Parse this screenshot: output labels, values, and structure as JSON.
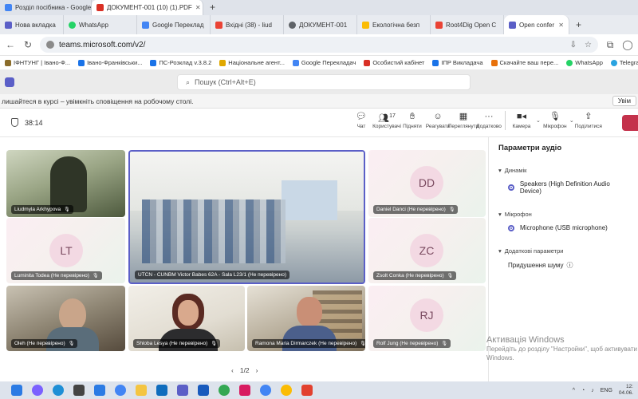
{
  "browser": {
    "top_tabs": [
      {
        "title": "Розділ посібника - Google Докум",
        "color": "#4285f4"
      },
      {
        "title": "ДОКУМЕНТ-001 (10) (1).PDF",
        "color": "#d93025"
      }
    ],
    "tabs": [
      {
        "title": "Нова вкладка",
        "color": "#5b5fc7"
      },
      {
        "title": "WhatsApp",
        "color": "#25d366"
      },
      {
        "title": "Google Переклад",
        "color": "#4285f4"
      },
      {
        "title": "Вхідні (38) - liud",
        "color": "#ea4335"
      },
      {
        "title": "ДОКУМЕНТ-001",
        "color": "#5f6368"
      },
      {
        "title": "Екологічна безп",
        "color": "#fbbc04"
      },
      {
        "title": "Root4Dig Open C",
        "color": "#ea4335"
      },
      {
        "title": "Open confer",
        "color": "#5b5fc7"
      }
    ],
    "url": "teams.microsoft.com/v2/",
    "bookmarks": [
      {
        "label": "ІФНТУНГ | Івано-Ф...",
        "color": "#8b6d2b"
      },
      {
        "label": "Івано-Франківськи...",
        "color": "#1a73e8"
      },
      {
        "label": "ПС-Розклад v.3.8.2",
        "color": "#1a73e8"
      },
      {
        "label": "Національне агент...",
        "color": "#e0a800"
      },
      {
        "label": "Google Перекладач",
        "color": "#4285f4"
      },
      {
        "label": "Особистий кабінет",
        "color": "#d93025"
      },
      {
        "label": "ІПР Викладача",
        "color": "#1a73e8"
      },
      {
        "label": "Скачайте ваш пере...",
        "color": "#e8710a"
      },
      {
        "label": "WhatsApp",
        "color": "#25d366"
      },
      {
        "label": "Telegram",
        "color": "#2aa3e0"
      }
    ]
  },
  "teams": {
    "search_placeholder": "Пошук (Ctrl+Alt+E)",
    "banner_text": "лишайтеся в курсі – увімкніть сповіщення на робочому столі.",
    "banner_button": "Увім"
  },
  "meeting": {
    "timer": "38:14",
    "participants_count": "17",
    "tools": {
      "chat": "Чат",
      "users": "Користувачі",
      "raise": "Підняти",
      "react": "Реагувати",
      "view": "Переглянути",
      "more": "Додатково",
      "camera": "Камера",
      "mic": "Мікрофон",
      "share": "Поділитися"
    },
    "tiles": [
      {
        "name": "Liudmyla Arkhypova"
      },
      {
        "name": "UTCN - CUNBM Victor Babes 62A - Sala L23/1 (Не перевірено)"
      },
      {
        "name": "Daniel Danci (Не перевірено)",
        "initials": "DD"
      },
      {
        "name": "Luminita Todea (Не перевірено)",
        "initials": "LT"
      },
      {
        "name": "Zsolt Conka (Не перевірено)",
        "initials": "ZC"
      },
      {
        "name": "Oleh (Не перевірено)"
      },
      {
        "name": "Shloba Lesya (Не перевірено)"
      },
      {
        "name": "Ramona Maria Dirmarczek (Не перевірено)"
      },
      {
        "name": "Rolf Jung (Не перевірено)",
        "initials": "RJ"
      }
    ],
    "pager": "1/2"
  },
  "audio_panel": {
    "title": "Параметри аудіо",
    "speaker_section": "Динамік",
    "speaker_value": "Speakers (High Definition Audio Device)",
    "mic_section": "Мікрофон",
    "mic_value": "Microphone (USB microphone)",
    "extra_section": "Додаткові параметри",
    "noise_label": "Придушення шуму"
  },
  "watermark": {
    "title": "Активація Windows",
    "body": "Перейдіть до розділу \"Настройки\", щоб активувати Windows."
  },
  "taskbar": {
    "lang": "ENG",
    "time": "12:",
    "date": "04.06.",
    "icons": [
      {
        "name": "start",
        "color": "#2b7be4"
      },
      {
        "name": "copilot",
        "color": "#7b61ff"
      },
      {
        "name": "edge",
        "color": "#1f8fd6"
      },
      {
        "name": "photos",
        "color": "#444"
      },
      {
        "name": "store",
        "color": "#2b7be4"
      },
      {
        "name": "chrome",
        "color": "#4285f4"
      },
      {
        "name": "explorer",
        "color": "#f4c542"
      },
      {
        "name": "outlook",
        "color": "#0f6cbd"
      },
      {
        "name": "teams",
        "color": "#5b5fc7"
      },
      {
        "name": "word",
        "color": "#185abd"
      },
      {
        "name": "chrome2",
        "color": "#34a853"
      },
      {
        "name": "app",
        "color": "#d81b60"
      },
      {
        "name": "chrome3",
        "color": "#4285f4"
      },
      {
        "name": "chrome4",
        "color": "#fbbc04"
      },
      {
        "name": "acrobat",
        "color": "#e2412f"
      }
    ]
  }
}
